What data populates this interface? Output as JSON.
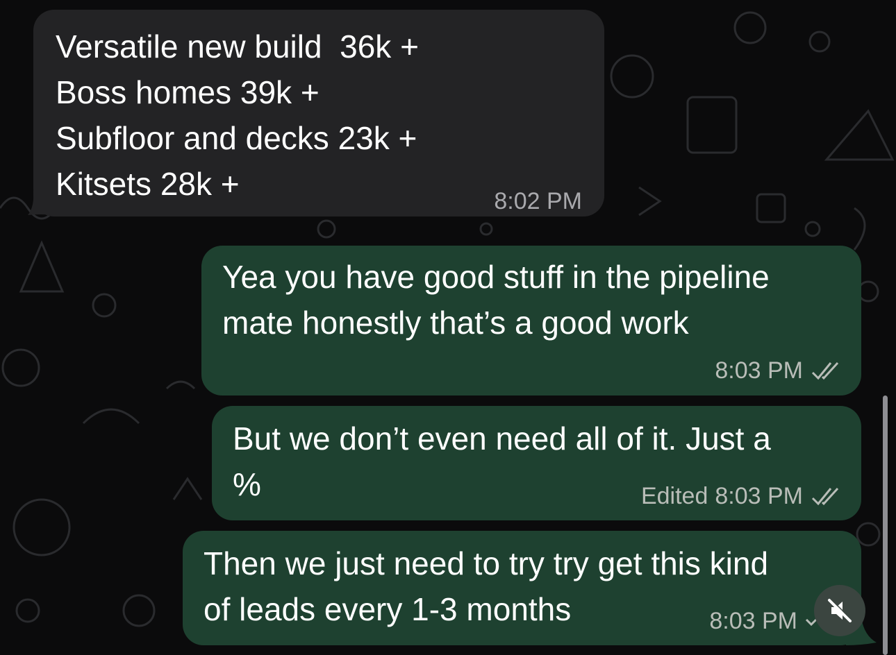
{
  "chat": {
    "messages": [
      {
        "direction": "incoming",
        "lines": [
          "Versatile new build  36k +",
          "Boss homes 39k +",
          "Subfloor and decks 23k +",
          "Kitsets 28k +"
        ],
        "time": "8:02 PM"
      },
      {
        "direction": "outgoing",
        "lines": [
          "Yea you have good stuff in the pipeline",
          "mate honestly that’s a good work"
        ],
        "time": "8:03 PM",
        "status": "read-double-check-icon"
      },
      {
        "direction": "outgoing",
        "lines": [
          "But we don’t even need all of it. Just a",
          "%"
        ],
        "edited_label": "Edited",
        "time": "8:03 PM",
        "status": "read-double-check-icon"
      },
      {
        "direction": "outgoing",
        "lines": [
          "Then we just need to try try get this kind",
          "of leads every 1-3 months"
        ],
        "time": "8:03 PM",
        "status": "sending-check-icon"
      }
    ]
  },
  "controls": {
    "mute_icon": "speaker-muted-icon"
  },
  "colors": {
    "background": "#0b0b0c",
    "incoming_bubble": "#232325",
    "outgoing_bubble": "#1e4130",
    "meta_text": "#b9bdb8"
  }
}
